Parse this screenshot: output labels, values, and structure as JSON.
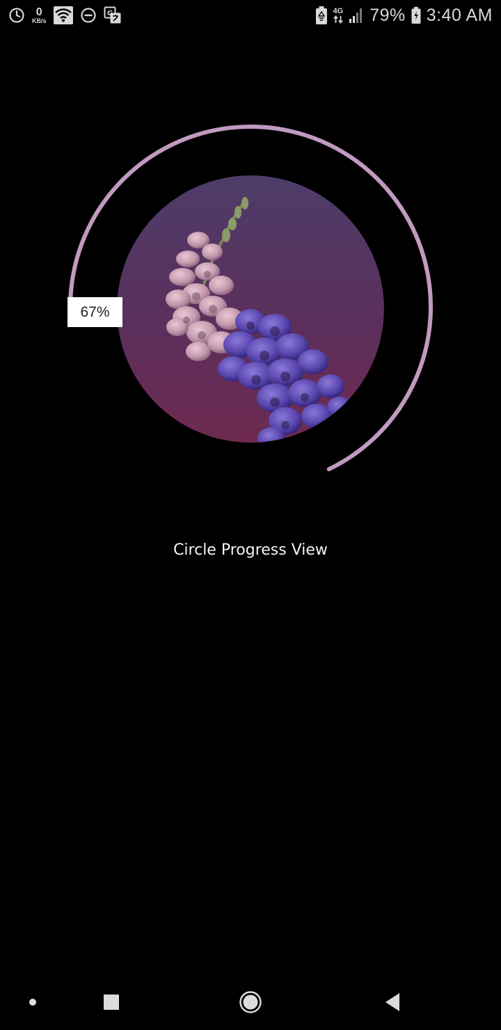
{
  "status_bar": {
    "data_speed_value": "0",
    "data_speed_unit": "KB/s",
    "network_type": "4G",
    "battery_percent": "79%",
    "time": "3:40 AM",
    "icons_left": [
      "sync-icon",
      "data-speed-indicator",
      "wifi-icon",
      "do-not-disturb-icon",
      "translate-icon"
    ],
    "icons_right": [
      "battery-saver-icon",
      "network-type-icon",
      "signal-icon",
      "battery-icon"
    ]
  },
  "progress": {
    "percent_label": "67%",
    "value": 67,
    "track_color": "#c09ac0",
    "album_art": "foxglove-flower-artwork"
  },
  "caption": {
    "text": "Circle Progress View"
  },
  "nav_bar": {
    "buttons": [
      "dot-button",
      "recents-button",
      "home-button",
      "back-button"
    ]
  }
}
